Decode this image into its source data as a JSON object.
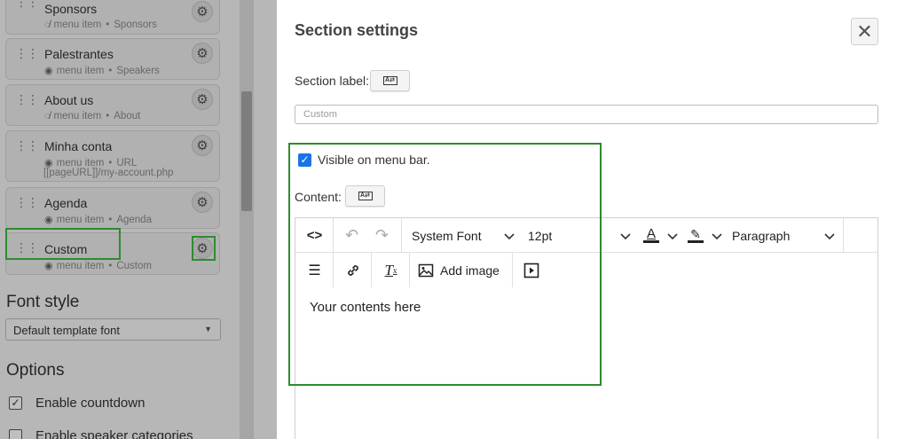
{
  "menu_items": [
    {
      "title": "Sponsors",
      "visibility_icon": "eye-slash-icon",
      "type": "menu item",
      "target": "Sponsors"
    },
    {
      "title": "Palestrantes",
      "visibility_icon": "eye-icon",
      "type": "menu item",
      "target": "Speakers"
    },
    {
      "title": "About us",
      "visibility_icon": "eye-slash-icon",
      "type": "menu item",
      "target": "About"
    },
    {
      "title": "Minha conta",
      "visibility_icon": "eye-icon",
      "type": "menu item",
      "target": "URL",
      "url": "[[pageURL]]/my-account.php"
    },
    {
      "title": "Agenda",
      "visibility_icon": "eye-icon",
      "type": "menu item",
      "target": "Agenda"
    },
    {
      "title": "Custom",
      "visibility_icon": "eye-icon",
      "type": "menu item",
      "target": "Custom"
    }
  ],
  "font_style": {
    "heading": "Font style",
    "selected": "Default template font"
  },
  "options": {
    "heading": "Options",
    "items": [
      {
        "label": "Enable countdown",
        "checked": true
      },
      {
        "label": "Enable speaker categories",
        "checked": false
      }
    ]
  },
  "modal": {
    "title": "Section settings",
    "close_icon": "close-icon",
    "section_label": "Section label:",
    "section_label_value": "Custom",
    "visible_label": "Visible on menu bar.",
    "visible_checked": true,
    "content_label": "Content:",
    "toolbar": {
      "font_family": "System Font",
      "font_size": "12pt",
      "block_format": "Paragraph",
      "add_image": "Add image",
      "text_color_icon": "A"
    },
    "editor_content": "Your contents here"
  },
  "colors": {
    "highlight": "#2e8b2e",
    "checkbox": "#1a73e8"
  }
}
